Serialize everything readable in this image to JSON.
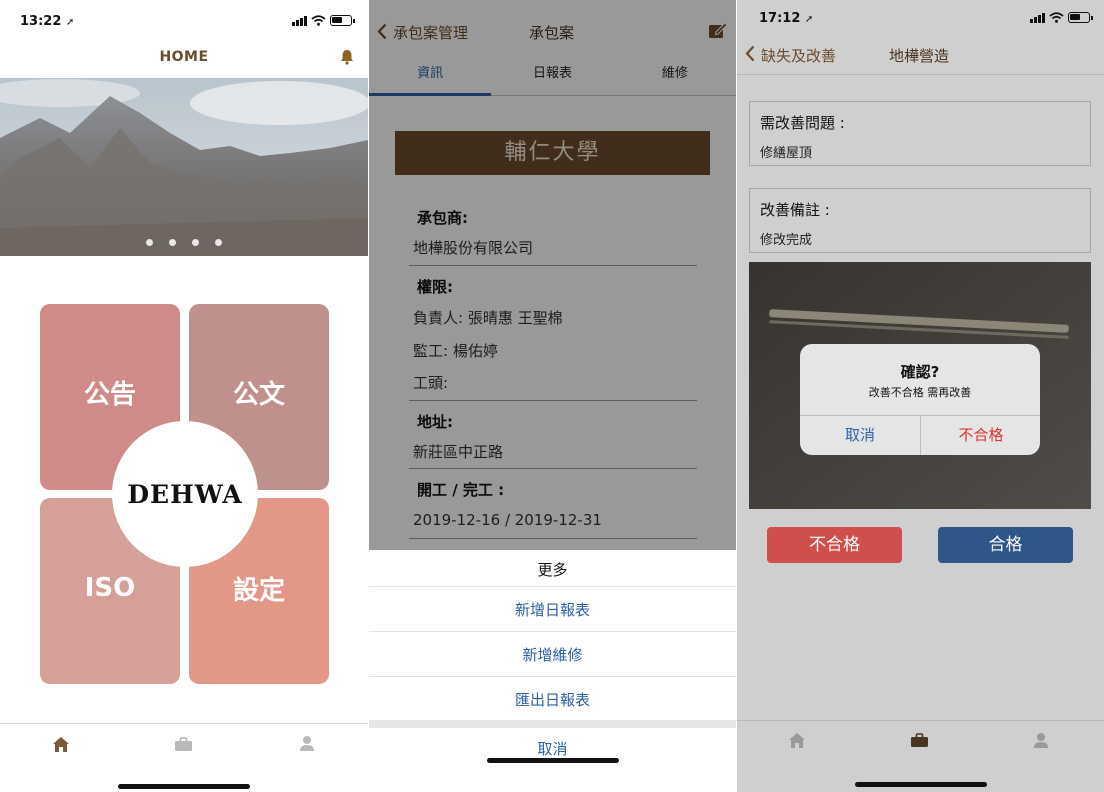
{
  "screen1": {
    "status": {
      "time": "13:22"
    },
    "header": {
      "title": "HOME"
    },
    "tiles": {
      "announcement": "公告",
      "document": "公文",
      "iso": "ISO",
      "settings": "設定"
    },
    "center_logo": "DEHWA",
    "carousel": {
      "dot_count": 4
    },
    "tabbar": {
      "items": [
        "home-icon",
        "briefcase-icon",
        "user-icon"
      ],
      "active": "home-icon"
    },
    "colors": {
      "brand_brown": "#6b4c2e",
      "tile_1": "#d08a87",
      "tile_2": "#c0908c",
      "tile_3": "#d4a097",
      "tile_4": "#e39786"
    }
  },
  "screen2": {
    "nav": {
      "back_label": "承包案管理",
      "title": "承包案"
    },
    "tabs": [
      {
        "label": "資訊",
        "active": true
      },
      {
        "label": "日報表",
        "active": false
      },
      {
        "label": "維修",
        "active": false
      }
    ],
    "school": "輔仁大學",
    "sections": {
      "contractor_label": "承包商:",
      "contractor_value": "地樺股份有限公司",
      "permission_label": "權限:",
      "owner": "負責人: 張晴惠 王聖棉",
      "supervisor": "監工: 楊佑婷",
      "foreman": "工頭:",
      "address_label": "地址:",
      "address_value": "新莊區中正路",
      "dates_label": "開工 / 完工 :",
      "dates_value": "2019-12-16 / 2019-12-31"
    },
    "action_sheet": {
      "title": "更多",
      "options": [
        "新增日報表",
        "新增維修",
        "匯出日報表"
      ],
      "cancel": "取消"
    },
    "colors": {
      "accent_blue": "#2c62a8"
    }
  },
  "screen3": {
    "status": {
      "time": "17:12"
    },
    "nav": {
      "back_label": "缺失及改善",
      "title": "地樺營造"
    },
    "issue": {
      "label": "需改善問題 :",
      "value": "修繕屋頂"
    },
    "note": {
      "label": "改善備註 :",
      "value": "修改完成"
    },
    "alert": {
      "title": "確認?",
      "message": "改善不合格 需再改善",
      "cancel": "取消",
      "confirm": "不合格"
    },
    "buttons": {
      "fail": "不合格",
      "pass": "合格"
    },
    "tabbar": {
      "items": [
        "home-icon",
        "briefcase-icon",
        "user-icon"
      ],
      "active": "briefcase-icon"
    },
    "colors": {
      "fail_red": "#cf4f4b",
      "pass_blue": "#2f5688",
      "alert_red": "#e0342c"
    }
  }
}
